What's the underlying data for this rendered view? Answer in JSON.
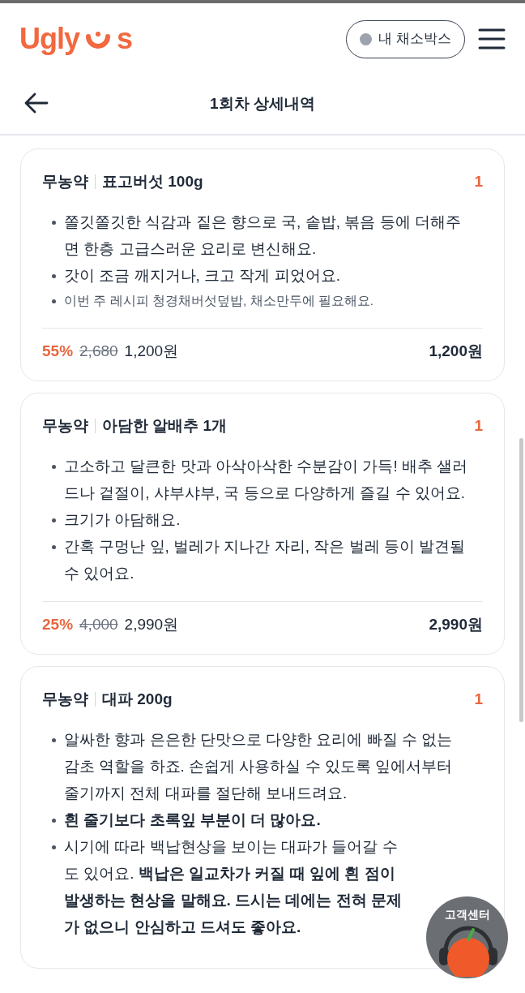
{
  "header": {
    "logo": {
      "left": "Ugly",
      "right": "s"
    },
    "box_button": {
      "label": "내 채소박스",
      "active": false
    }
  },
  "title_bar": {
    "title": "1회차 상세내역"
  },
  "items": [
    {
      "tag": "무농약",
      "name": "표고버섯 100g",
      "quantity": "1",
      "bullets": [
        {
          "kind": "plain",
          "text": "쫄깃쫄깃한 식감과 짙은 향으로 국, 솥밥, 볶음 등에 더해주면 한층 고급스러운 요리로 변신해요."
        },
        {
          "kind": "plain",
          "text": "갓이 조금 깨지거나, 크고 작게 피었어요."
        },
        {
          "kind": "note",
          "text": "이번 주 레시피 청경채버섯덮밥, 채소만두에 필요해요."
        }
      ],
      "discount": "55%",
      "original_price": "2,680",
      "price": "1,200원",
      "total": "1,200원"
    },
    {
      "tag": "무농약",
      "name": "아담한 알배추 1개",
      "quantity": "1",
      "bullets": [
        {
          "kind": "plain",
          "text": "고소하고 달큰한 맛과 아삭아삭한 수분감이 가득! 배추 샐러드나 겉절이, 샤부샤부, 국 등으로 다양하게 즐길 수 있어요."
        },
        {
          "kind": "plain",
          "text": "크기가 아담해요."
        },
        {
          "kind": "plain",
          "text": "간혹 구멍난 잎, 벌레가 지나간 자리, 작은 벌레 등이 발견될 수 있어요."
        }
      ],
      "discount": "25%",
      "original_price": "4,000",
      "price": "2,990원",
      "total": "2,990원"
    },
    {
      "tag": "무농약",
      "name": "대파 200g",
      "quantity": "1",
      "bullets": [
        {
          "kind": "plain",
          "text": "알싸한 향과 은은한 단맛으로 다양한 요리에 빠질 수 없는 감초 역할을 하죠. 손쉽게 사용하실 수 있도록 잎에서부터 줄기까지 전체 대파를 절단해 보내드려요."
        },
        {
          "kind": "emphasis",
          "text": "흰 줄기보다 초록잎 부분이 더 많아요."
        },
        {
          "kind": "plain",
          "text": "시기에 따라 백납현상을 보이는 대파가 들어갈 수도 있어요. **백납은 일교차가 커질 때 잎에 흰 점이 발생하는 현상을 말해요. 드시는 데에는 전혀 문제가 없으니 안심하고 드셔도 좋아요.**"
        }
      ]
    }
  ],
  "support": {
    "label": "고객센터"
  }
}
